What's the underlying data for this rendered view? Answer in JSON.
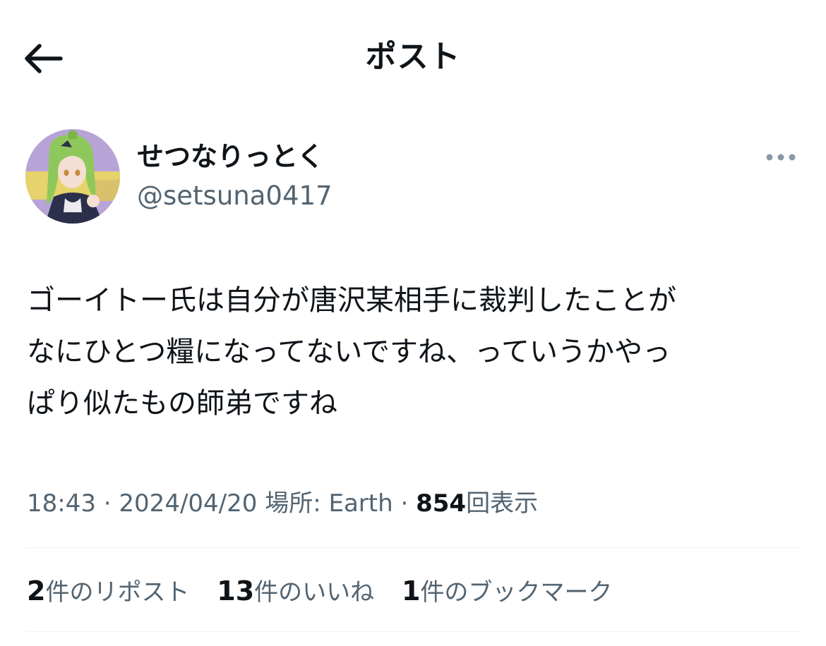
{
  "header": {
    "title": "ポスト",
    "back_icon": "arrow-left-icon"
  },
  "author": {
    "display_name": "せつなりっとく",
    "handle": "@setsuna0417",
    "more_icon": "more-horizontal-icon"
  },
  "post": {
    "text": "ゴーイトー氏は自分が唐沢某相手に裁判したことが\nなにひとつ糧になってないですね、っていうかやっ\nぱり似たもの師弟ですね"
  },
  "meta": {
    "time": "18:43",
    "separator": "·",
    "date": "2024/04/20",
    "location_label": "場所:",
    "location": "Earth",
    "views": "854",
    "views_label": "回表示"
  },
  "stats": {
    "reposts_count": "2",
    "reposts_label": "件のリポスト",
    "likes_count": "13",
    "likes_label": "件のいいね",
    "bookmarks_count": "1",
    "bookmarks_label": "件のブックマーク"
  },
  "colors": {
    "text_primary": "#0f1419",
    "text_secondary": "#536471",
    "divider": "#eff3f4"
  }
}
